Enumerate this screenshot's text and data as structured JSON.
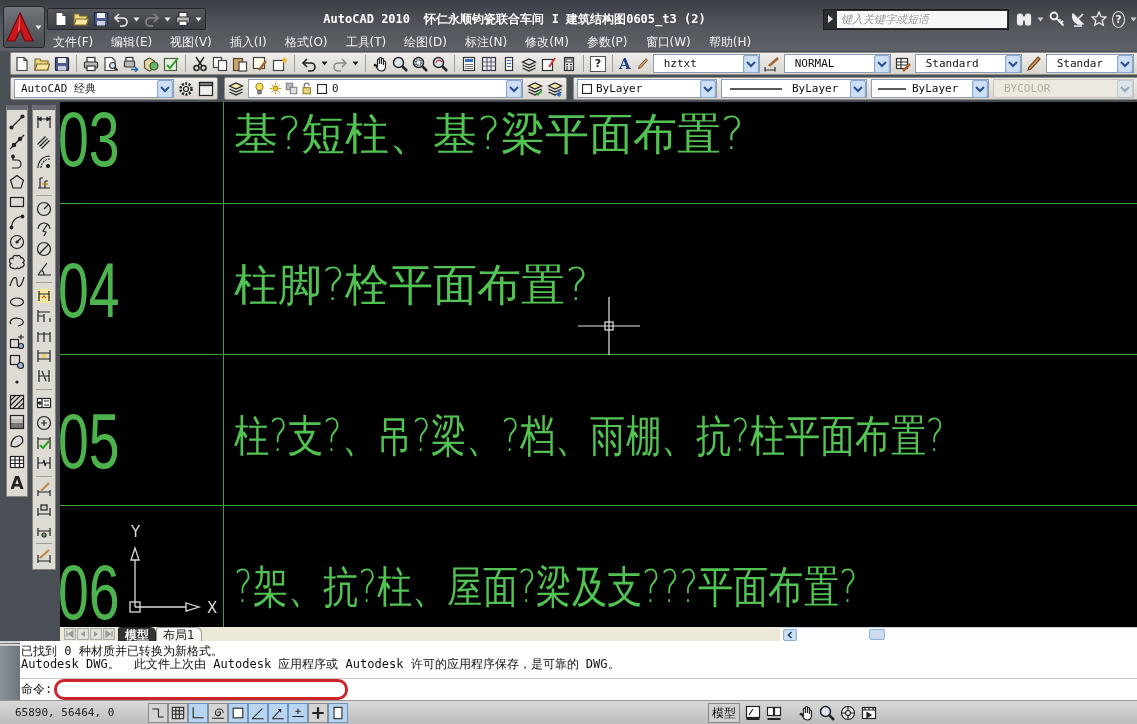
{
  "window": {
    "title": "AutoCAD 2010  怀仁永顺钧瓷联合车间 I 建筑结构图0605_t3 (2)"
  },
  "info_center": {
    "placeholder": "键入关键字或短语",
    "help_glyph": "?"
  },
  "menu": [
    "文件(F)",
    "编辑(E)",
    "视图(V)",
    "插入(I)",
    "格式(O)",
    "工具(T)",
    "绘图(D)",
    "标注(N)",
    "修改(M)",
    "参数(P)",
    "窗口(W)",
    "帮助(H)"
  ],
  "standard_toolbar": {
    "help_glyph": "?",
    "styles": [
      {
        "kind": "text",
        "glyph": "A",
        "value": "hztxt"
      },
      {
        "kind": "dimension",
        "value": "NORMAL"
      },
      {
        "kind": "table",
        "value": "Standard"
      },
      {
        "kind": "multileader",
        "value": "Standar"
      }
    ]
  },
  "workspace": {
    "value": "AutoCAD 经典"
  },
  "layer": {
    "value": "0"
  },
  "properties": [
    {
      "kind": "color",
      "value": "ByLayer",
      "disabled": false
    },
    {
      "kind": "linetype",
      "value": "ByLayer",
      "disabled": false
    },
    {
      "kind": "lineweight",
      "value": "ByLayer",
      "disabled": false
    },
    {
      "kind": "plotstyle",
      "value": "BYCOLOR",
      "disabled": true
    }
  ],
  "draw_toolbar": {
    "text_glyph": "A"
  },
  "drawing": {
    "rows": [
      {
        "number": "03",
        "title": "基?短柱、基?梁平面布置?"
      },
      {
        "number": "04",
        "title": "柱脚?栓平面布置?"
      },
      {
        "number": "05",
        "title": "柱?支?、吊?梁、?档、雨棚、抗?柱平面布置?"
      },
      {
        "number": "06",
        "title": "?架、抗?柱、屋面?梁及支???平面布置?"
      }
    ],
    "ucs": {
      "y_label": "Y",
      "x_label": "X"
    }
  },
  "layout_tabs": [
    {
      "label": "模型",
      "selected": true
    },
    {
      "label": "布局1",
      "selected": false
    }
  ],
  "command_window": {
    "history": [
      "已找到 0 种材质并已转换为新格式。",
      "Autodesk DWG。  此文件上次由 Autodesk 应用程序或 Autodesk 许可的应用程序保存，是可靠的 DWG。"
    ],
    "prompt": "命令:",
    "highlighted": true
  },
  "status_bar": {
    "coordinates": "65890, 56464, 0",
    "toggles": [
      {
        "kind": "snap",
        "on": false
      },
      {
        "kind": "grid",
        "on": false
      },
      {
        "kind": "ortho",
        "on": true
      },
      {
        "kind": "polar",
        "on": false
      },
      {
        "kind": "osnap",
        "on": true
      },
      {
        "kind": "otrack",
        "on": true
      },
      {
        "kind": "ducs",
        "on": true
      },
      {
        "kind": "dyn",
        "on": true
      },
      {
        "kind": "lwt",
        "on": false
      },
      {
        "kind": "qp",
        "on": true
      }
    ],
    "model_button": "模型"
  }
}
